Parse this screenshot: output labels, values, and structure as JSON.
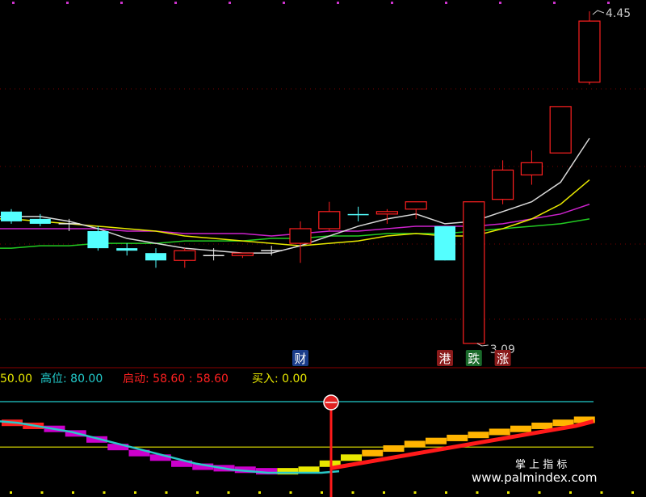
{
  "chart_data": [
    {
      "type": "candlestick",
      "annotations": {
        "high": "4.45",
        "low": "3.09"
      },
      "markers": [
        {
          "label": "财",
          "candle": 10,
          "bg": "#1a3c8a"
        },
        {
          "label": "港",
          "candle": 15,
          "bg": "#8a1a1a"
        },
        {
          "label": "跌",
          "candle": 16,
          "bg": "#1a6a2a"
        },
        {
          "label": "涨",
          "candle": 17,
          "bg": "#8a1a1a"
        }
      ],
      "candles": [
        {
          "o": 3.63,
          "h": 3.64,
          "l": 3.58,
          "c": 3.59,
          "color": "cyan"
        },
        {
          "o": 3.6,
          "h": 3.62,
          "l": 3.57,
          "c": 3.58,
          "color": "cyan"
        },
        {
          "o": 3.58,
          "h": 3.6,
          "l": 3.55,
          "c": 3.58,
          "color": "white"
        },
        {
          "o": 3.55,
          "h": 3.57,
          "l": 3.47,
          "c": 3.48,
          "color": "cyan"
        },
        {
          "o": 3.48,
          "h": 3.5,
          "l": 3.45,
          "c": 3.47,
          "color": "cyan"
        },
        {
          "o": 3.46,
          "h": 3.48,
          "l": 3.4,
          "c": 3.43,
          "color": "cyan"
        },
        {
          "o": 3.43,
          "h": 3.48,
          "l": 3.4,
          "c": 3.47,
          "color": "red"
        },
        {
          "o": 3.45,
          "h": 3.48,
          "l": 3.43,
          "c": 3.45,
          "color": "white"
        },
        {
          "o": 3.45,
          "h": 3.46,
          "l": 3.44,
          "c": 3.46,
          "color": "red"
        },
        {
          "o": 3.47,
          "h": 3.49,
          "l": 3.45,
          "c": 3.47,
          "color": "white"
        },
        {
          "o": 3.5,
          "h": 3.59,
          "l": 3.42,
          "c": 3.56,
          "color": "red"
        },
        {
          "o": 3.56,
          "h": 3.67,
          "l": 3.55,
          "c": 3.63,
          "color": "red"
        },
        {
          "o": 3.62,
          "h": 3.65,
          "l": 3.59,
          "c": 3.62,
          "color": "cyan"
        },
        {
          "o": 3.62,
          "h": 3.64,
          "l": 3.58,
          "c": 3.63,
          "color": "red"
        },
        {
          "o": 3.64,
          "h": 3.67,
          "l": 3.6,
          "c": 3.67,
          "color": "red"
        },
        {
          "o": 3.57,
          "h": 3.57,
          "l": 3.43,
          "c": 3.43,
          "color": "cyan"
        },
        {
          "o": 3.09,
          "h": 3.67,
          "l": 3.09,
          "c": 3.67,
          "color": "red"
        },
        {
          "o": 3.68,
          "h": 3.84,
          "l": 3.66,
          "c": 3.8,
          "color": "red"
        },
        {
          "o": 3.78,
          "h": 3.88,
          "l": 3.74,
          "c": 3.83,
          "color": "red"
        },
        {
          "o": 3.87,
          "h": 4.06,
          "l": 3.87,
          "c": 4.06,
          "color": "red"
        },
        {
          "o": 4.16,
          "h": 4.45,
          "l": 4.15,
          "c": 4.41,
          "color": "red"
        }
      ],
      "ma_white": [
        3.61,
        3.61,
        3.59,
        3.56,
        3.52,
        3.5,
        3.48,
        3.47,
        3.46,
        3.46,
        3.49,
        3.53,
        3.57,
        3.6,
        3.62,
        3.58,
        3.59,
        3.63,
        3.67,
        3.75,
        3.93
      ],
      "ma_yellow": [
        3.6,
        3.59,
        3.58,
        3.57,
        3.56,
        3.55,
        3.53,
        3.52,
        3.51,
        3.5,
        3.49,
        3.5,
        3.51,
        3.53,
        3.54,
        3.53,
        3.53,
        3.56,
        3.6,
        3.66,
        3.76
      ],
      "ma_magenta": [
        3.56,
        3.56,
        3.56,
        3.56,
        3.55,
        3.55,
        3.54,
        3.54,
        3.54,
        3.53,
        3.54,
        3.55,
        3.55,
        3.56,
        3.57,
        3.57,
        3.57,
        3.58,
        3.6,
        3.62,
        3.66
      ],
      "ma_green": [
        3.48,
        3.49,
        3.49,
        3.5,
        3.5,
        3.5,
        3.51,
        3.51,
        3.51,
        3.52,
        3.52,
        3.53,
        3.53,
        3.54,
        3.54,
        3.54,
        3.55,
        3.56,
        3.57,
        3.58,
        3.6
      ]
    },
    {
      "type": "indicator",
      "legend": [
        {
          "text": "50.00",
          "color": "#e8e800"
        },
        {
          "text": "高位: 80.00",
          "color": "#22cccc"
        },
        {
          "text": "启动: 58.60 : 58.60",
          "color": "#ff2020"
        },
        {
          "text": "买入: 0.00",
          "color": "#e8e800"
        }
      ],
      "levels": {
        "high": 80,
        "mid": 50
      },
      "ylim": [
        25,
        88
      ],
      "line_values": [
        67,
        66,
        65,
        63,
        61,
        58,
        55,
        52,
        49,
        46,
        43,
        40,
        37,
        35,
        33,
        32,
        32,
        32,
        33,
        34,
        35,
        36,
        38,
        40,
        42,
        44,
        46,
        48,
        50,
        52,
        54,
        56,
        57,
        58,
        59,
        60,
        61,
        62,
        63,
        64,
        65,
        66,
        67,
        69
      ],
      "bars": [
        {
          "v": 66,
          "c": "red"
        },
        {
          "v": 64,
          "c": "red"
        },
        {
          "v": 62,
          "c": "magenta"
        },
        {
          "v": 59,
          "c": "magenta"
        },
        {
          "v": 55,
          "c": "magenta"
        },
        {
          "v": 50,
          "c": "magenta"
        },
        {
          "v": 46,
          "c": "magenta"
        },
        {
          "v": 43,
          "c": "magenta"
        },
        {
          "v": 39,
          "c": "magenta"
        },
        {
          "v": 37,
          "c": "magenta"
        },
        {
          "v": 36,
          "c": "magenta"
        },
        {
          "v": 35,
          "c": "magenta"
        },
        {
          "v": 34,
          "c": "magenta"
        },
        {
          "v": 34,
          "c": "yellow"
        },
        {
          "v": 35,
          "c": "yellow"
        },
        {
          "v": 39,
          "c": "yellow"
        },
        {
          "v": 43,
          "c": "yellow"
        },
        {
          "v": 46,
          "c": "gold"
        },
        {
          "v": 49,
          "c": "gold"
        },
        {
          "v": 52,
          "c": "gold"
        },
        {
          "v": 54,
          "c": "gold"
        },
        {
          "v": 56,
          "c": "gold"
        },
        {
          "v": 58,
          "c": "gold"
        },
        {
          "v": 60,
          "c": "gold"
        },
        {
          "v": 62,
          "c": "gold"
        },
        {
          "v": 64,
          "c": "gold"
        },
        {
          "v": 66,
          "c": "gold"
        },
        {
          "v": 68,
          "c": "gold"
        }
      ],
      "red_line": [
        0,
        0,
        0,
        0,
        0,
        0,
        0,
        0,
        0,
        0,
        0,
        0,
        0,
        0,
        0,
        0,
        0,
        0,
        0,
        0,
        0,
        0,
        0,
        0,
        0,
        0,
        0,
        0,
        0,
        0,
        0,
        36,
        38,
        40,
        42,
        44,
        46,
        48,
        50,
        52,
        54,
        56,
        58,
        60,
        62,
        64,
        67
      ]
    }
  ],
  "watermark": {
    "line1": "掌 上 指 标",
    "line2": "www.palmindex.com"
  },
  "colors": {
    "up": "#ff2020",
    "down": "#54ffff",
    "grid": "#7a0000"
  }
}
